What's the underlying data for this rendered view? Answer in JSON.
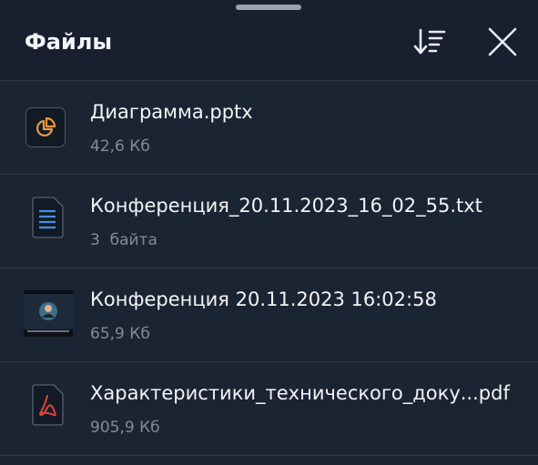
{
  "header": {
    "title": "Файлы",
    "sort_icon": "sort-descending-icon",
    "close_icon": "close-icon"
  },
  "colors": {
    "background": "#1b2433",
    "header_background": "#182030",
    "text_primary": "#f2f4f7",
    "text_secondary": "#818b99",
    "divider": "#2c3747",
    "pptx_accent": "#e79a45",
    "txt_accent": "#4a90d9",
    "pdf_accent": "#e0433a"
  },
  "files": [
    {
      "name": "Диаграмма.pptx",
      "size": "42,6 Кб",
      "icon": "pie-chart-file-icon"
    },
    {
      "name": "Конференция_20.11.2023_16_02_55.txt",
      "size": "3  байта",
      "icon": "text-document-icon"
    },
    {
      "name": "Конференция 20.11.2023 16:02:58",
      "size": "65,9 Кб",
      "icon": "video-thumbnail"
    },
    {
      "name": "Характеристики_технического_доку...pdf",
      "size": "905,9 Кб",
      "icon": "pdf-document-icon"
    }
  ]
}
